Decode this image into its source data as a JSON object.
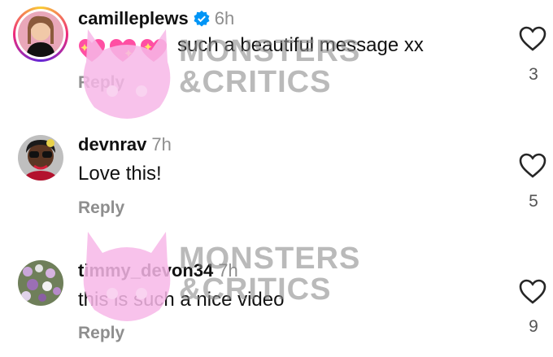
{
  "comments": [
    {
      "username": "camilleplews",
      "verified": true,
      "time": "6h",
      "text": "such a beautiful message xx",
      "emoji_prefix": "sparkling-heart-emoji x3",
      "reply_label": "Reply",
      "likes": "3"
    },
    {
      "username": "devnrav",
      "verified": false,
      "time": "7h",
      "text": "Love this!",
      "reply_label": "Reply",
      "likes": "5"
    },
    {
      "username": "timmy_devon34",
      "verified": false,
      "time": "7h",
      "text": "this is such a nice video",
      "reply_label": "Reply",
      "likes": "9"
    }
  ],
  "watermark": {
    "line1": "MONSTERS",
    "line2": "&CRITICS"
  },
  "colors": {
    "secondary_text": "#8e8e8e",
    "verified_blue": "#0095f6",
    "watermark_pink": "#f7b7e8"
  }
}
